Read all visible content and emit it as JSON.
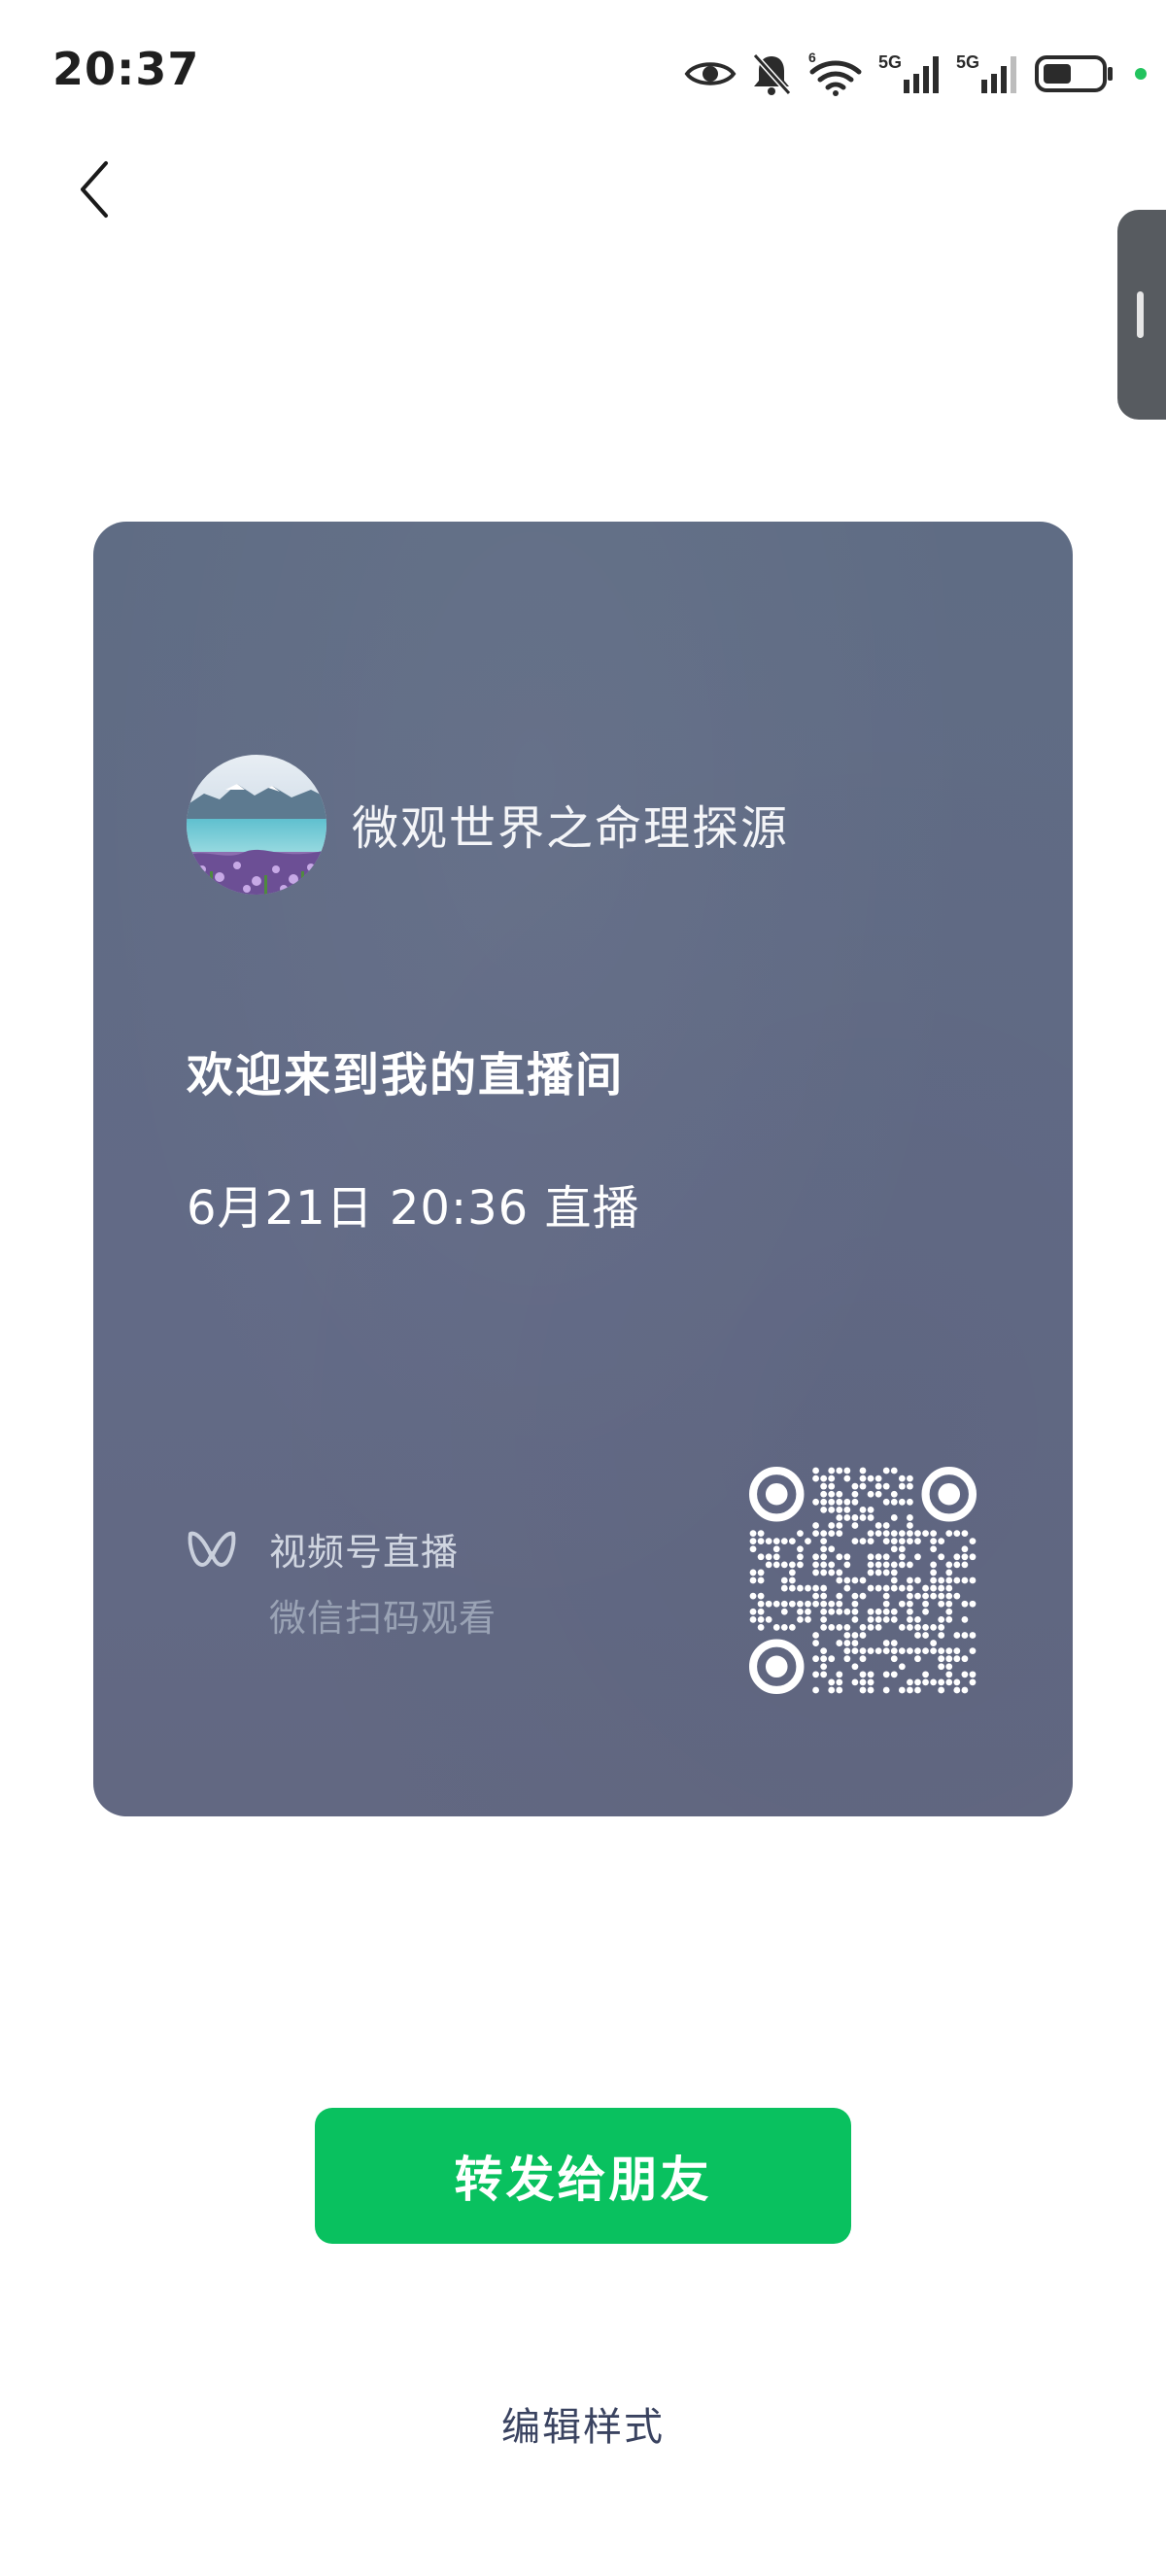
{
  "status_bar": {
    "time": "20:37",
    "icons": [
      "eye-icon",
      "bell-muted-icon",
      "wifi-icon",
      "signal-5g-icon",
      "signal-5g-icon",
      "battery-icon",
      "green-dot"
    ],
    "network_label_1": "5G",
    "network_label_2": "5G",
    "wifi_badge": "6"
  },
  "nav": {
    "back_icon": "chevron-left-icon"
  },
  "card": {
    "channel_name": "微观世界之命理探源",
    "live_title": "欢迎来到我的直播间",
    "live_time": "6月21日 20:36 直播",
    "footer_label": "视频号直播",
    "footer_hint": "微信扫码观看",
    "background_color": "#626a86"
  },
  "actions": {
    "share_label": "转发给朋友",
    "edit_label": "编辑样式",
    "accent_color": "#09c15f"
  }
}
